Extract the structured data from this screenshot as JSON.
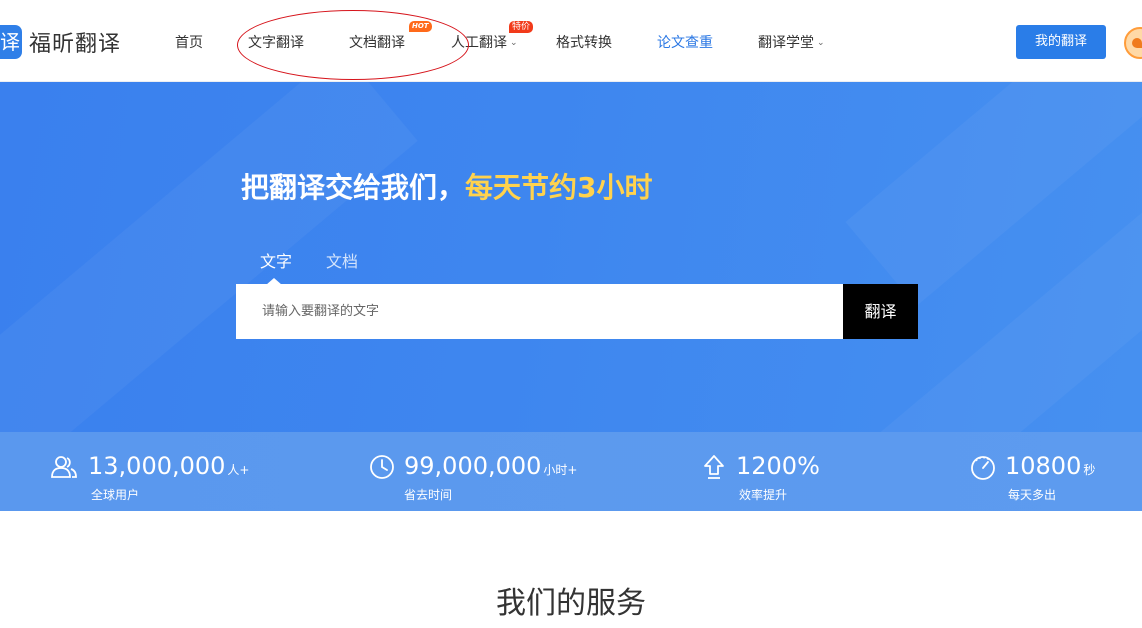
{
  "brand": {
    "logo_glyph": "译",
    "name": "福昕翻译",
    "accent": "#2a7de8"
  },
  "nav": {
    "items": [
      {
        "label": "首页"
      },
      {
        "label": "文字翻译"
      },
      {
        "label": "文档翻译",
        "badge": "HOT"
      },
      {
        "label": "人工翻译",
        "badge": "特价",
        "has_dropdown": true
      },
      {
        "label": "格式转换"
      },
      {
        "label": "论文查重",
        "active": true
      },
      {
        "label": "翻译学堂",
        "has_dropdown": true
      }
    ],
    "dropdown_glyph": "⌄"
  },
  "header": {
    "my_translation_label": "我的翻译"
  },
  "hero": {
    "slogan_main": "把翻译交给我们，",
    "slogan_highlight": "每天节约3小时",
    "highlight_color": "#ffd24d",
    "tabs": [
      {
        "label": "文字",
        "active": true
      },
      {
        "label": "文档"
      }
    ],
    "search_placeholder": "请输入要翻译的文字",
    "search_value": "",
    "translate_label": "翻译"
  },
  "stats": [
    {
      "icon": "users-icon",
      "value": "13,000,000",
      "unit": "人+",
      "label": "全球用户"
    },
    {
      "icon": "clock-icon",
      "value": "99,000,000",
      "unit": "小时+",
      "label": "省去时间"
    },
    {
      "icon": "arrow-up-icon",
      "value": "1200%",
      "unit": "",
      "label": "效率提升"
    },
    {
      "icon": "timer-icon",
      "value": "10800",
      "unit": "秒",
      "label": "每天多出"
    }
  ],
  "services": {
    "title": "我们的服务"
  }
}
